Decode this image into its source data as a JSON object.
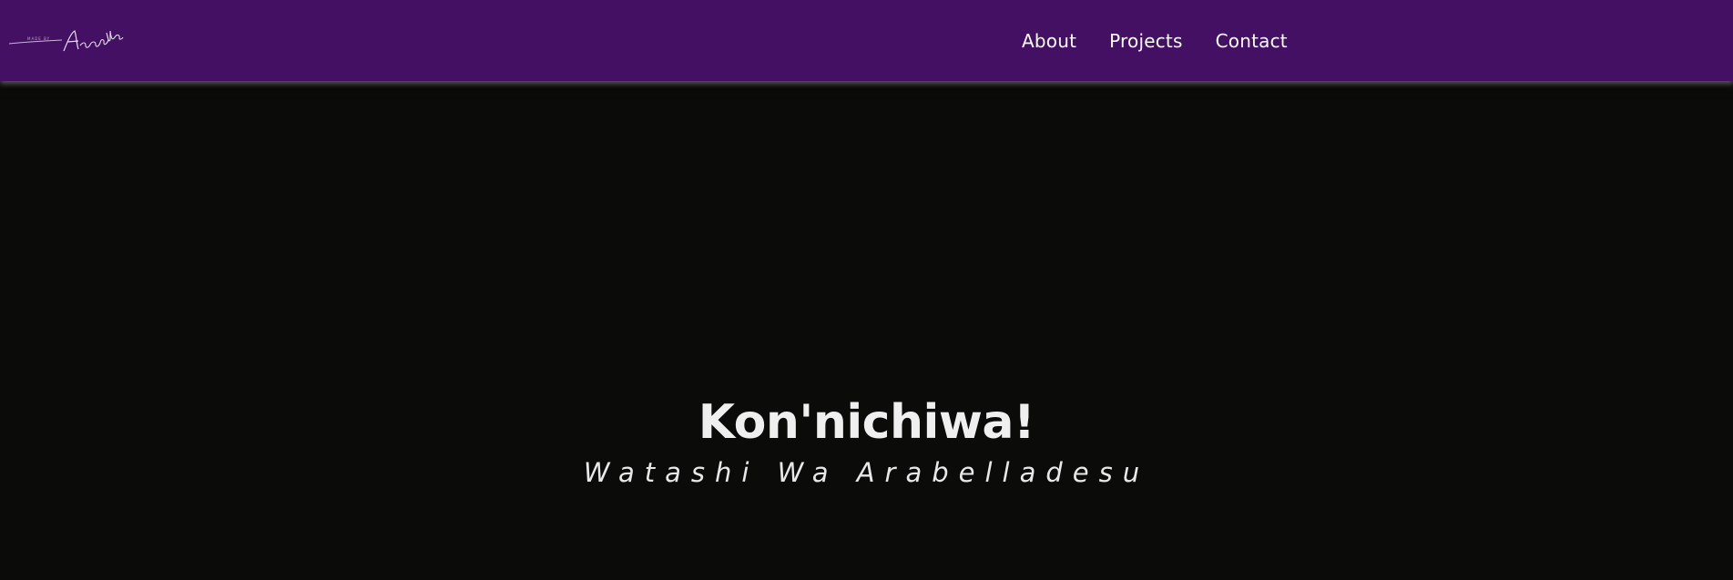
{
  "navbar": {
    "logo_alt": "Arabella",
    "links": [
      {
        "label": "About"
      },
      {
        "label": "Projects"
      },
      {
        "label": "Contact"
      }
    ],
    "background": "#431063"
  },
  "hero": {
    "title": "Kon'nichiwa!",
    "subtitle": "Watashi Wa Arabelladesu",
    "background": "#0b0b0a"
  }
}
